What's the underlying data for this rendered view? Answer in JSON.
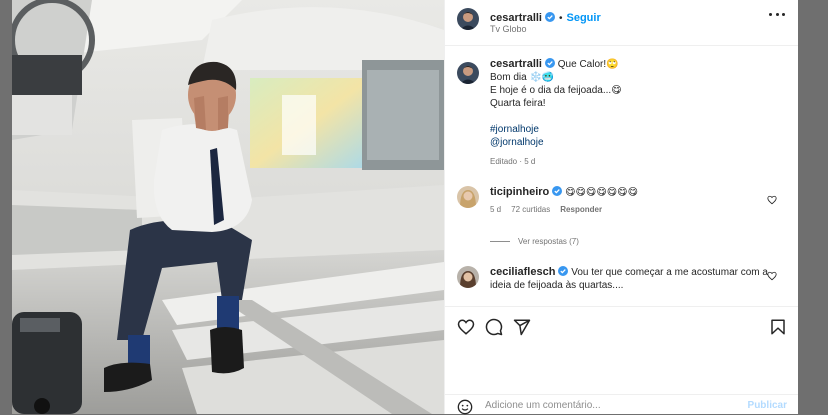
{
  "post": {
    "author": {
      "username": "cesartralli",
      "follow_label": "Seguir",
      "location": "Tv Globo"
    },
    "caption": {
      "username": "cesartralli",
      "lines": [
        "Que Calor!🙄",
        "Bom dia ❄️🥶",
        "E hoje é o dia da feijoada...😋",
        "Quarta feira!"
      ],
      "hashtags": [
        "#jornalhoje",
        "@jornalhoje"
      ],
      "meta": "Editado · 5 d"
    },
    "comments": [
      {
        "username": "ticipinheiro",
        "text": "😋😋😋😋😋😋😋",
        "age": "5 d",
        "likes": "72 curtidas",
        "reply_label": "Responder",
        "view_replies": "Ver respostas (7)"
      },
      {
        "username": "ceciliaflesch",
        "text": "Vou ter que começar a me acostumar com a ideia de feijoada às quartas...."
      }
    ],
    "add_comment": {
      "placeholder": "Adicione um comentário...",
      "publish_label": "Publicar"
    }
  },
  "icons": {
    "verified": "verified-badge-icon",
    "more": "more-options-icon",
    "like": "heart-icon",
    "comment": "comment-icon",
    "share": "share-icon",
    "save": "bookmark-icon",
    "emoji": "emoji-icon"
  },
  "colors": {
    "link_blue": "#0095f6",
    "hashtag_blue": "#00376b",
    "muted": "#737373",
    "publish_disabled": "#b3dbff"
  }
}
